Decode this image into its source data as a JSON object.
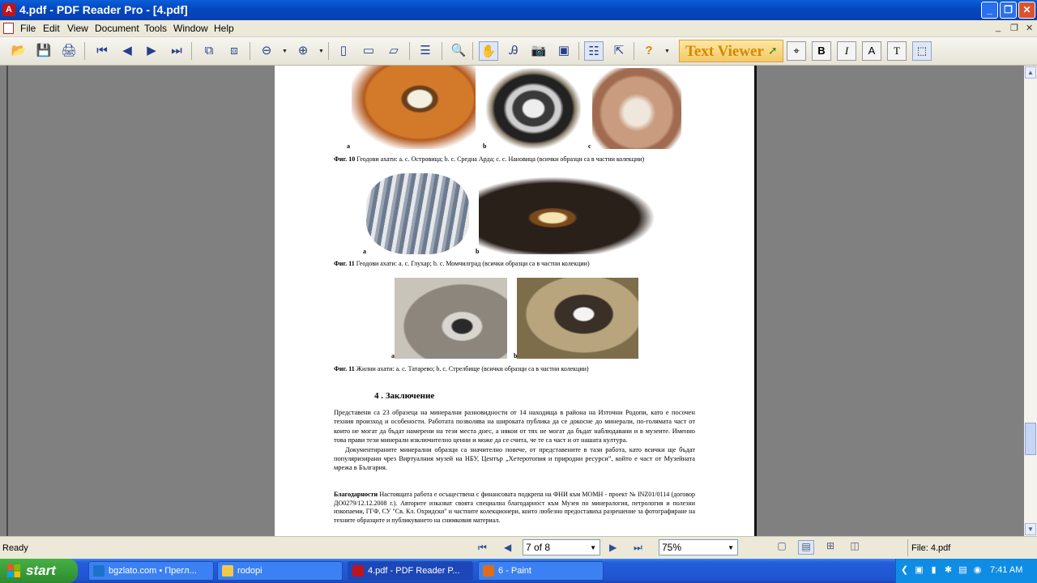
{
  "window": {
    "title": "4.pdf - PDF Reader Pro - [4.pdf]",
    "app_icon": "pdf-app-icon",
    "buttons": {
      "minimize": "_",
      "maximize": "❐",
      "close": "✕"
    }
  },
  "menu": {
    "items": [
      "File",
      "Edit",
      "View",
      "Document",
      "Tools",
      "Window",
      "Help"
    ],
    "mdi": {
      "minimize": "_",
      "restore": "❐",
      "close": "✕"
    }
  },
  "toolbar": {
    "text_viewer_label": "Text Viewer",
    "icons": {
      "open": "📂",
      "save": "💾",
      "print": "🖨",
      "first": "⏮",
      "prev": "◀",
      "next": "▶",
      "last": "⏭",
      "zoom_out": "⊖",
      "zoom_in": "⊕",
      "find": "🔍",
      "hand": "✋",
      "help": "?",
      "bold": "B",
      "italic": "I",
      "text_a": "A",
      "text_t": "T"
    }
  },
  "document": {
    "fig10_labels": [
      "a",
      "b",
      "c"
    ],
    "fig10_caption_bold": "Фиг. 10",
    "fig10_caption": " Геодови ахати: a. с. Островица; b. с. Средна Арда; c. с. Нановица (всички образци са в частни колекции)",
    "fig11a_labels": [
      "a",
      "b"
    ],
    "fig11a_caption_bold": "Фиг. 11",
    "fig11a_caption": " Геодови ахати: a. с. Глухар; b. с. Момчилград (всички образци са в частни колекции)",
    "fig11b_labels": [
      "a",
      "b"
    ],
    "fig11b_caption_bold": "Фиг. 11",
    "fig11b_caption": " Жилни ахати: a. с. Татарево; b. с. Стрелбище (всички образци са в частни колекции)",
    "section_heading": "4 .   Заключение",
    "para1": "Представени са 23 образеца на минерални разновидности от 14 находища в района на Източни Родопи, като е посочен техния произход и особености. Работата позволява на широката публика да се докосне до минерали, по-голямата част от които не могат да бъдат намерени на тези места днес, а някои от тях не могат да бъдат наблюдавани и в музеите. Именно това прави тези минерали изключително ценни и може да се счита, че те са част и от нашата култура.",
    "para2": "Документираните минерални образци са значително повече, от представените в тази работа, като всички ще бъдат популяризирани чрез Виртуалния музей на НБУ, Център „Хетеротопия и природни ресурси”, който е част от Музейната мрежа в България.",
    "ack_bold": "Благодарности",
    "ack": " Настоящата работа е осъществена с финансовата подкрепа на ФНИ към МОМН - проект № INZ01/0114 (договор ДО0279/12.12.2008 г.). Авторите изказват своята специална благодарност към Музея по минералогия, петрология и полезни изкопаеми, ГГФ, СУ \"Св. Кл. Охридски\" и частните колекционери, които любезно предоставиха разрешение за фотографиране на техните образците и публикуването на снимковия материал."
  },
  "statusbar": {
    "status": "Ready",
    "page_indicator": "7 of 8",
    "zoom": "75%",
    "file": "File: 4.pdf",
    "nav_icons": {
      "first": "⏮",
      "prev": "◀",
      "next": "▶",
      "last": "⏭"
    }
  },
  "taskbar": {
    "start_label": "start",
    "tasks": [
      {
        "label": "bgzlato.com • Прегл...",
        "icon": "ie-icon"
      },
      {
        "label": "rodopi",
        "icon": "folder-icon"
      },
      {
        "label": "4.pdf - PDF Reader P...",
        "icon": "pdf-app-icon"
      },
      {
        "label": "6 - Paint",
        "icon": "paint-icon"
      }
    ],
    "clock": "7:41 AM"
  },
  "colors": {
    "title_bar": "#0447c0",
    "taskbar": "#1f54d0",
    "start_button": "#2e8b2e",
    "workspace": "#808080",
    "text_viewer": "#d28a00"
  }
}
